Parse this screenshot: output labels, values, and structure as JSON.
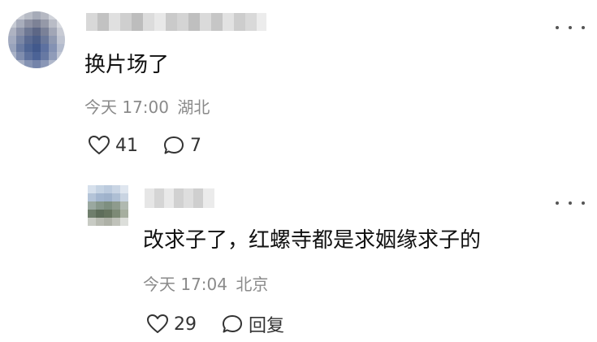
{
  "comments": [
    {
      "text": "换片场了",
      "time": "今天 17:00",
      "location": "湖北",
      "likes": "41",
      "replies": "7"
    },
    {
      "text": "改求子了，红螺寺都是求姻缘求子的",
      "time": "今天 17:04",
      "location": "北京",
      "likes": "29",
      "reply_label": "回复"
    }
  ]
}
